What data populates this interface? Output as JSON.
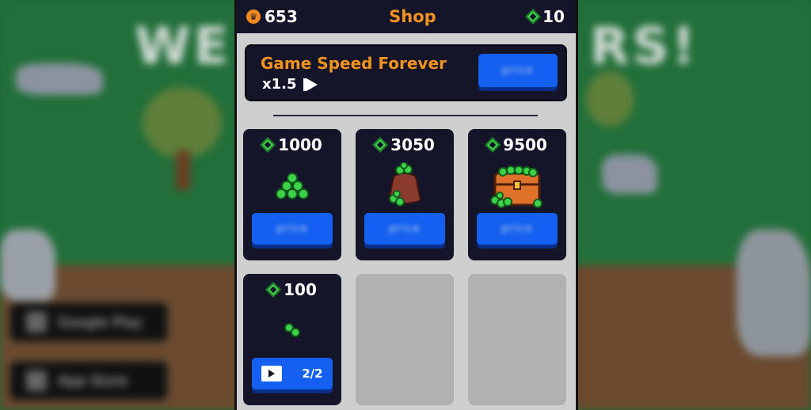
{
  "header": {
    "crowns": "653",
    "title": "Shop",
    "gems": "10"
  },
  "background": {
    "title_left": "WE",
    "title_right": "RS!",
    "badge_google": "Google Play",
    "badge_apple": "App Store"
  },
  "speed_offer": {
    "title": "Game Speed Forever",
    "multiplier": "x1.5",
    "button_label": "price"
  },
  "packs": [
    {
      "amount": "1000",
      "icon": "gem-pile-icon",
      "button_label": "price"
    },
    {
      "amount": "3050",
      "icon": "gem-sack-icon",
      "button_label": "price"
    },
    {
      "amount": "9500",
      "icon": "treasure-chest-icon",
      "button_label": "price"
    },
    {
      "amount": "100",
      "icon": "gem-pair-icon",
      "video_count": "2/2"
    }
  ],
  "colors": {
    "accent_orange": "#f29320",
    "panel_dark": "#15152a",
    "button_blue": "#1460f0",
    "gem_green": "#3cd34a"
  }
}
